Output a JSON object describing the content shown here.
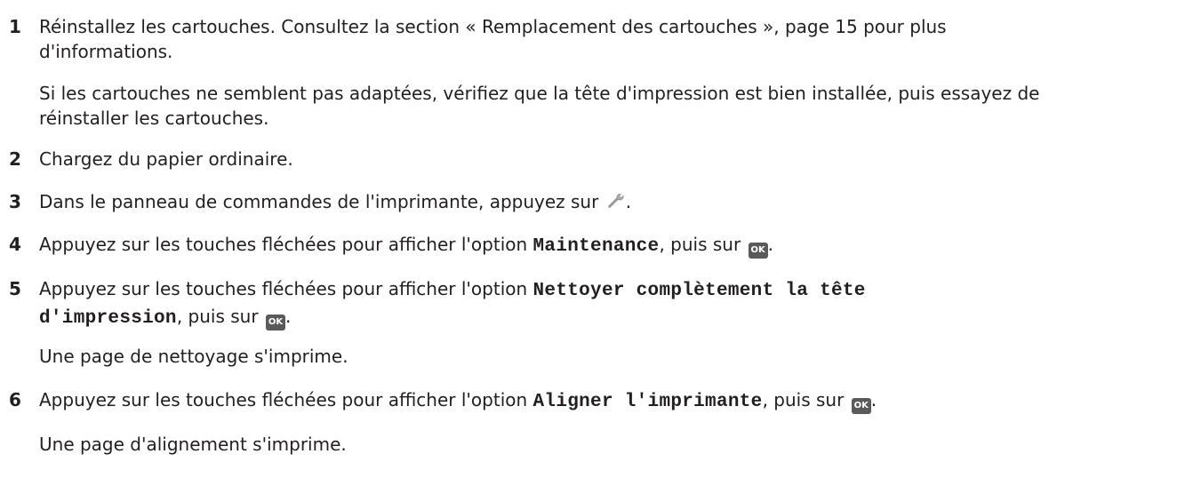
{
  "steps": [
    {
      "number": "1",
      "text_a": "Réinstallez les cartouches. Consultez la section « Remplacement des cartouches », page 15 pour plus",
      "text_b": "d'informations.",
      "note_a": "Si les cartouches ne semblent pas adaptées, vérifiez que la tête d'impression est bien installée, puis essayez de",
      "note_b": "réinstaller les cartouches."
    },
    {
      "number": "2",
      "text": "Chargez du papier ordinaire."
    },
    {
      "number": "3",
      "text": "Dans le panneau de commandes de l'imprimante, appuyez sur",
      "icon": "wrench-icon",
      "tail": "."
    },
    {
      "number": "4",
      "text": "Appuyez sur les touches fléchées pour afficher l'option",
      "option": "Maintenance",
      "text_after": ", puis sur",
      "button": "OK",
      "tail": "."
    },
    {
      "number": "5",
      "text": "Appuyez sur les touches fléchées pour afficher l'option",
      "option_a": "Nettoyer complètement la tête",
      "option_b": "d'impression",
      "text_after": ", puis sur",
      "button": "OK",
      "tail": ".",
      "result": "Une page de nettoyage s'imprime."
    },
    {
      "number": "6",
      "text": "Appuyez sur les touches fléchées pour afficher l'option",
      "option": "Aligner l'imprimante",
      "text_after": ", puis sur",
      "button": "OK",
      "tail": ".",
      "result": "Une page d'alignement s'imprime."
    }
  ],
  "colors": {
    "text": "#231f20",
    "ok_button": "#5a5a5a"
  }
}
